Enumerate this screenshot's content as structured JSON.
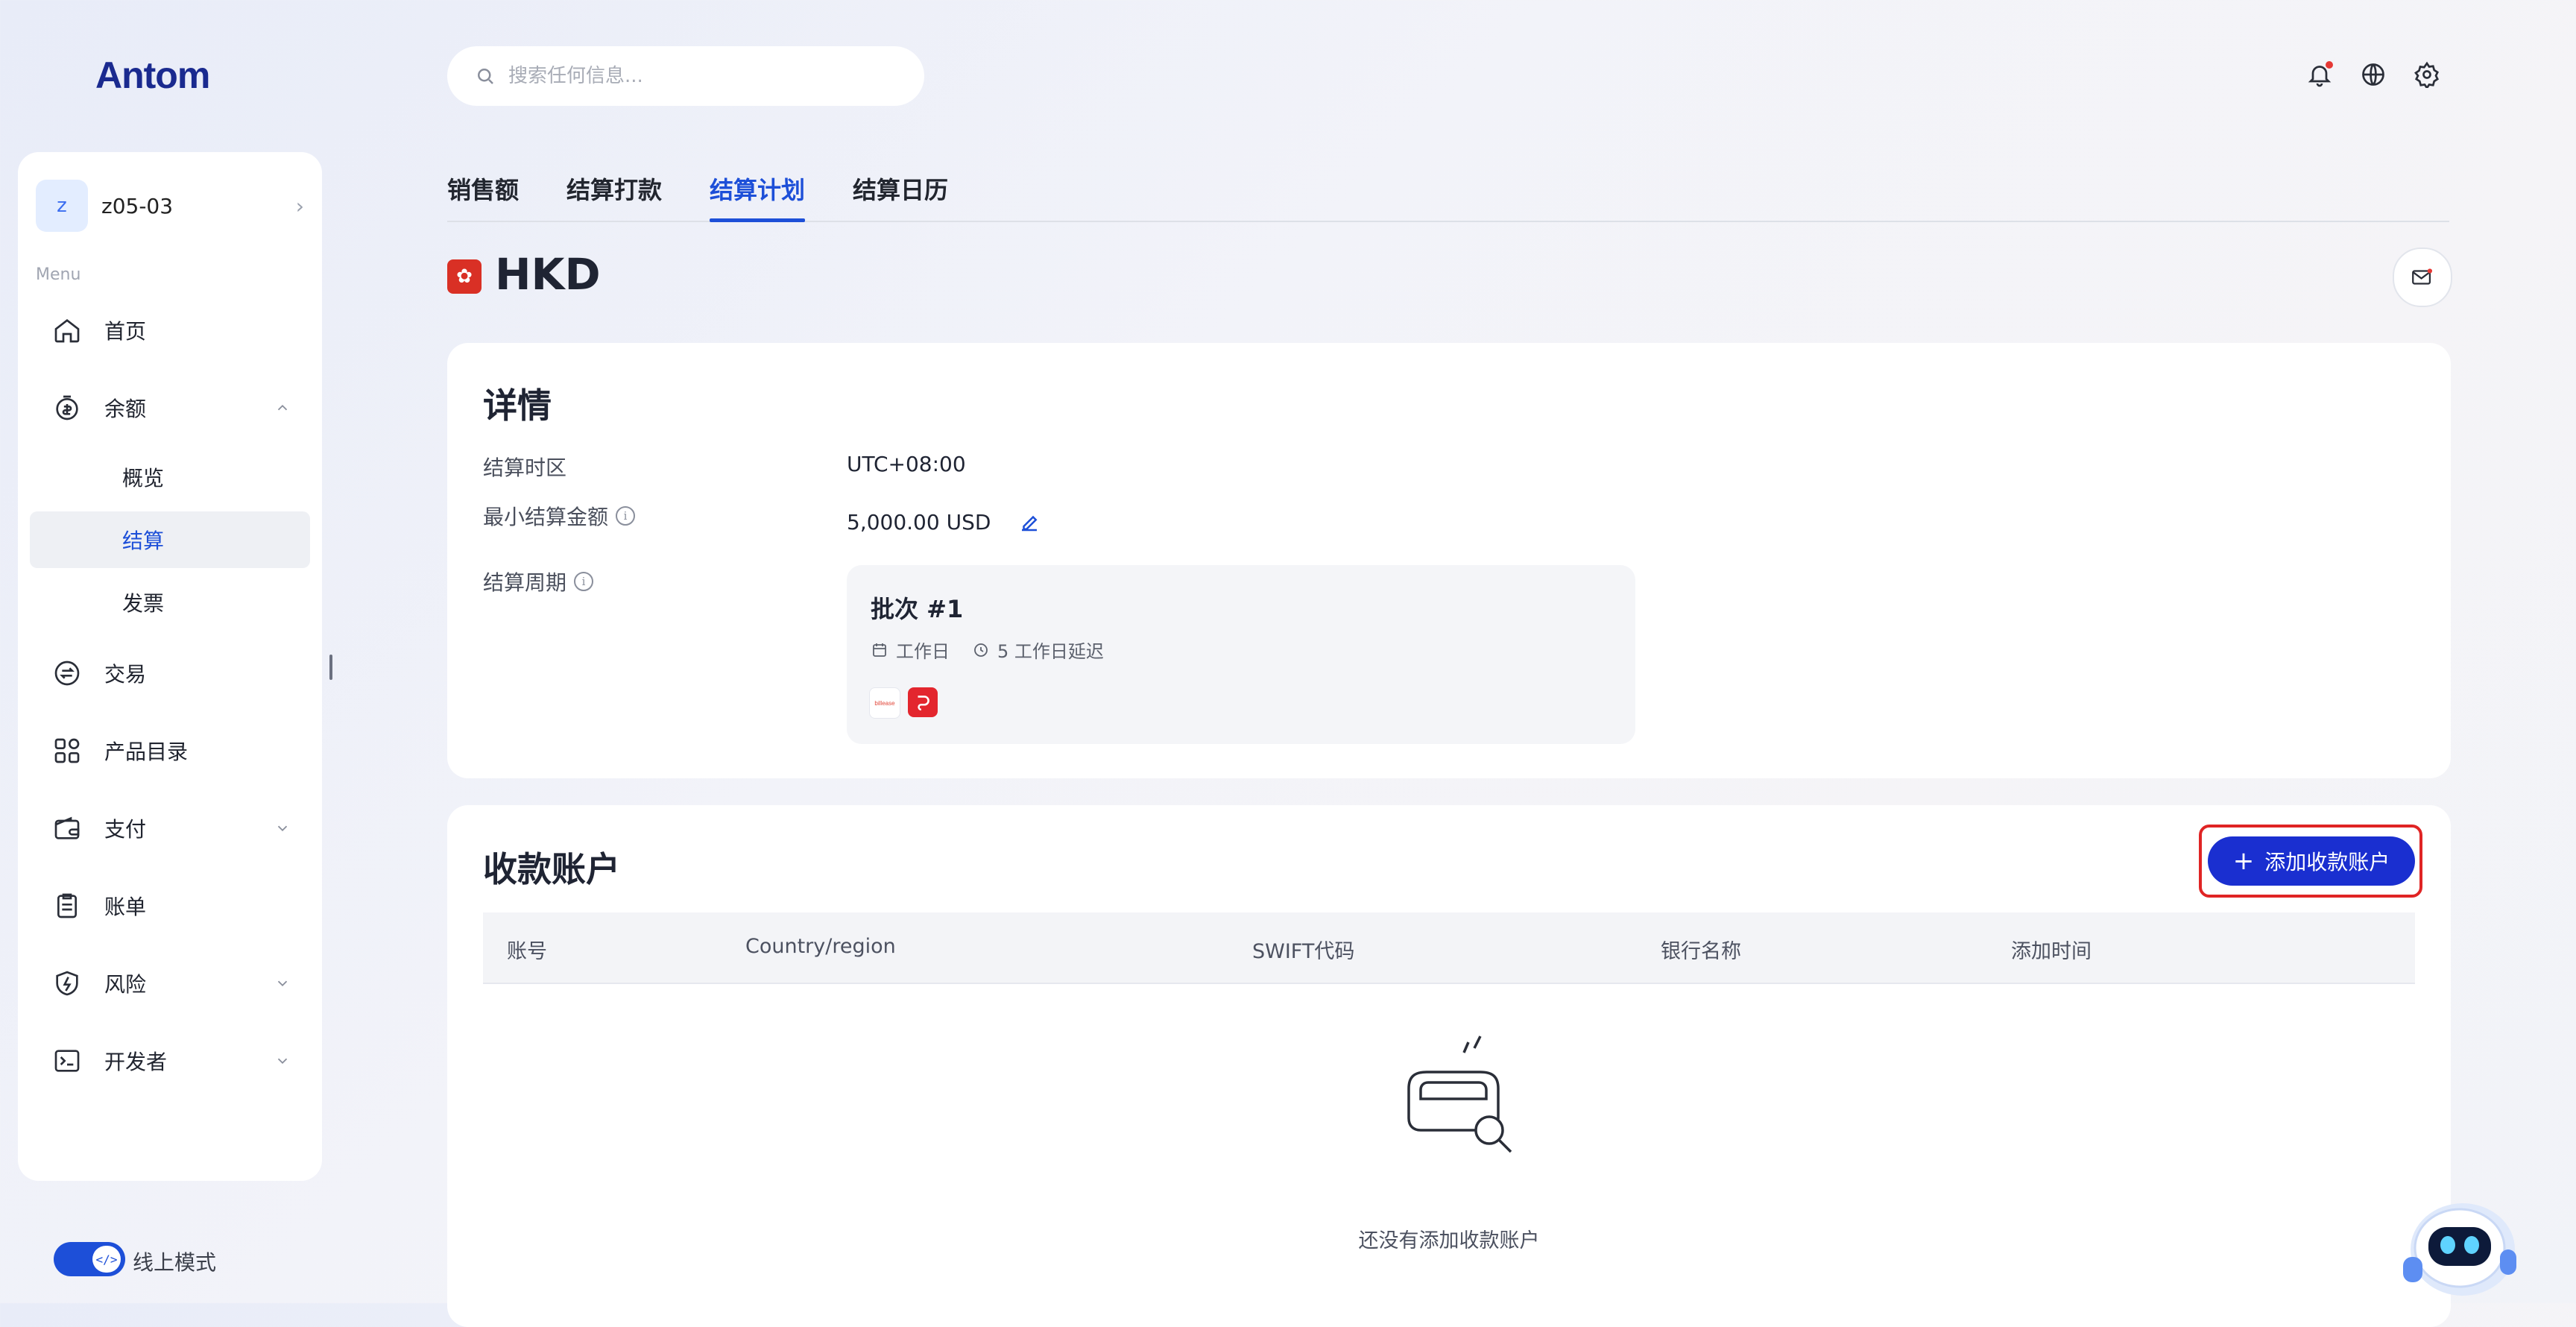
{
  "app": {
    "logo_text": "Antom"
  },
  "sidebar": {
    "merchant": {
      "avatar_letter": "z",
      "name": "z05-03"
    },
    "menu_label": "Menu",
    "items": [
      {
        "label": "首页",
        "icon": "home-icon"
      },
      {
        "label": "余额",
        "icon": "balance-icon",
        "expanded": true
      },
      {
        "label": "交易",
        "icon": "transaction-icon"
      },
      {
        "label": "产品目录",
        "icon": "catalog-icon"
      },
      {
        "label": "支付",
        "icon": "wallet-icon"
      },
      {
        "label": "账单",
        "icon": "bill-icon"
      },
      {
        "label": "风险",
        "icon": "shield-icon"
      },
      {
        "label": "开发者",
        "icon": "terminal-icon"
      }
    ],
    "balance_sub": [
      {
        "label": "概览"
      },
      {
        "label": "结算",
        "active": true
      },
      {
        "label": "发票"
      }
    ],
    "mode_label": "线上模式",
    "mode_knob": "</>"
  },
  "search": {
    "placeholder": "搜索任何信息..."
  },
  "tabs": [
    {
      "label": "销售额"
    },
    {
      "label": "结算打款"
    },
    {
      "label": "结算计划",
      "active": true
    },
    {
      "label": "结算日历"
    }
  ],
  "currency": {
    "code": "HKD",
    "flag_glyph": "✿"
  },
  "details": {
    "title": "详情",
    "timezone_label": "结算时区",
    "timezone_value": "UTC+08:00",
    "min_amount_label": "最小结算金额",
    "min_amount_value": "5,000.00 USD",
    "cycle_label": "结算周期",
    "batch": {
      "title": "批次 #1",
      "day_type": "工作日",
      "delay": "5 工作日延迟",
      "logos": [
        "billease-logo",
        "red-wallet-logo"
      ],
      "billease_text": "billease"
    }
  },
  "accounts": {
    "title": "收款账户",
    "add_label": "添加收款账户",
    "columns": [
      "账号",
      "Country/region",
      "SWIFT代码",
      "银行名称",
      "添加时间"
    ],
    "empty_text": "还没有添加收款账户"
  },
  "colors": {
    "accent": "#1d4fd8",
    "button": "#1a2fd0",
    "highlight": "#e02424"
  }
}
